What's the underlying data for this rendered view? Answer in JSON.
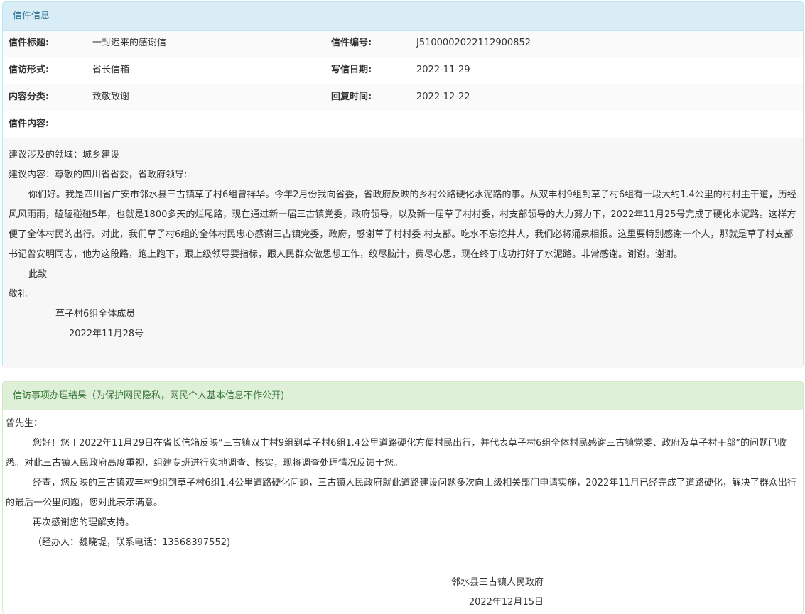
{
  "letter_panel": {
    "heading": "信件信息",
    "rows": [
      {
        "label1": "信件标题:",
        "value1": "一封迟来的感谢信",
        "label2": "信件编号:",
        "value2": "J5100002022112900852"
      },
      {
        "label1": "信访形式:",
        "value1": "省长信箱",
        "label2": "写信日期:",
        "value2": "2022-11-29"
      },
      {
        "label1": "内容分类:",
        "value1": "致敬致谢",
        "label2": "回复时间:",
        "value2": "2022-12-22"
      }
    ],
    "content_label": "信件内容:",
    "content": {
      "domain": "建议涉及的领域：城乡建设",
      "intro": "建议内容：尊敬的四川省省委，省政府领导:",
      "body": "你们好。我是四川省广安市邻水县三古镇草子村6组曾祥华。今年2月份我向省委，省政府反映的乡村公路硬化水泥路的事。从双丰村9组到草子村6组有一段大约1.4公里的村村主干道，历经风风雨雨，磕磕碰碰5年，也就是1800多天的烂尾路，现在通过新一届三古镇党委，政府领导，以及新一届草子村村委，村支部领导的大力努力下，2022年11月25号完成了硬化水泥路。这样方便了全体村民的出行。对此，我们草子村6组的全体村民忠心感谢三古镇党委，政府，感谢草子村村委 村支部。吃水不忘挖井人，我们必将涌泉相报。这里要特别感谢一个人，那就是草子村支部书记曾安明同志，他为这段路，跑上跑下，跟上级领导要指标，跟人民群众做思想工作，绞尽脑汁，费尽心思，现在终于成功打好了水泥路。非常感谢。谢谢。谢谢。",
      "closing1": "此致",
      "closing2": "敬礼",
      "signer": "草子村6组全体成员",
      "date": "2022年11月28号"
    }
  },
  "reply_panel": {
    "heading": "信访事项办理结果（为保护网民隐私，网民个人基本信息不作公开)",
    "salutation": "曾先生：",
    "para1": "您好！您于2022年11月29日在省长信箱反映“三古镇双丰村9组到草子村6组1.4公里道路硬化方便村民出行，并代表草子村6组全体村民感谢三古镇党委、政府及草子村干部”的问题已收悉。对此三古镇人民政府高度重视，组建专班进行实地调查、核实，现将调查处理情况反馈于您。",
    "para2": "经查，您反映的三古镇双丰村9组到草子村6组1.4公里道路硬化问题，三古镇人民政府就此道路建设问题多次向上级相关部门申请实施，2022年11月已经完成了道路硬化，解决了群众出行的最后一公里问题，您对此表示满意。",
    "para3": "再次感谢您的理解支持。",
    "handler": "（经办人：魏晓堤，联系电话：13568397552)",
    "org": "邻水县三古镇人民政府",
    "date": "2022年12月15日"
  }
}
